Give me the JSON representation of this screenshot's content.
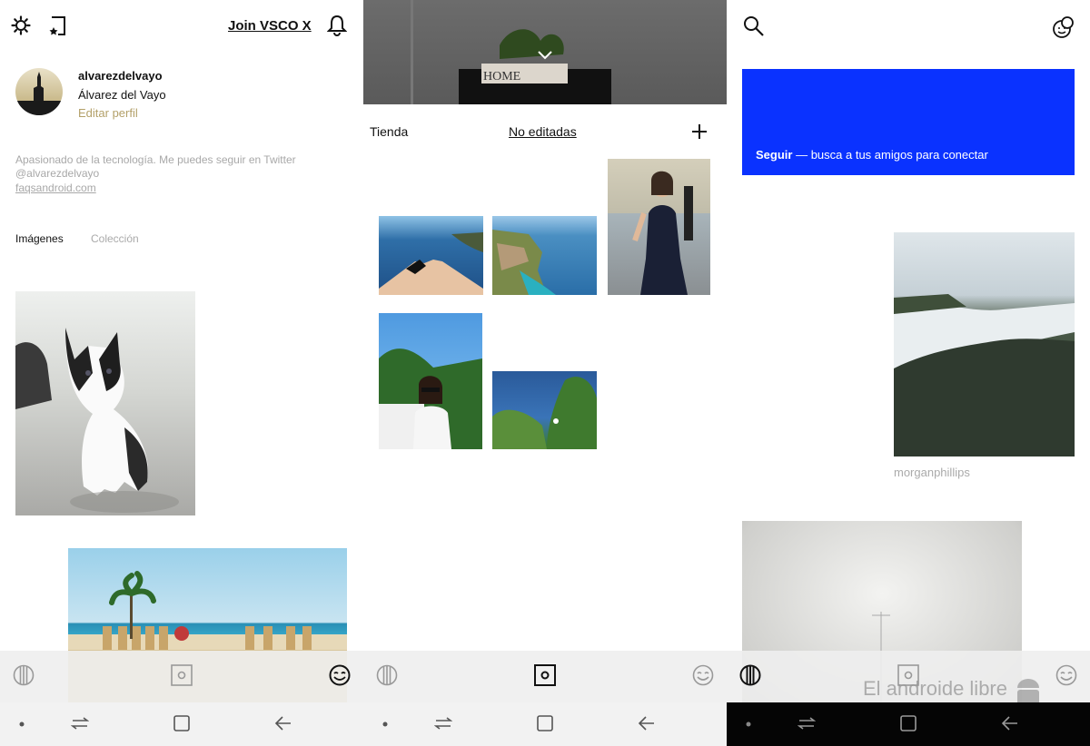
{
  "profile": {
    "join_label": "Join VSCO X",
    "username": "alvarezdelvayo",
    "display_name": "Álvarez del Vayo",
    "edit_label": "Editar perfil",
    "bio_line1": "Apasionado de la tecnología. Me puedes seguir en Twitter",
    "bio_line2": "@alvarezdelvayo",
    "link": "faqsandroid.com",
    "tabs": [
      "Imágenes",
      "Colección"
    ]
  },
  "studio": {
    "shop_label": "Tienda",
    "filter_label": "No editadas"
  },
  "feed": {
    "banner_bold": "Seguir",
    "banner_text": " — busca a tus amigos para conectar",
    "user1": "morganphillips"
  },
  "watermark": "El androide libre",
  "colors": {
    "accent_gold": "#b3a069",
    "banner_blue": "#0a32ff"
  },
  "icons": [
    "settings-icon",
    "bookmark-star-icon",
    "bell-icon",
    "chevron-down-icon",
    "plus-icon",
    "search-icon",
    "faces-icon",
    "feed-icon",
    "studio-icon",
    "profile-face-icon",
    "dot-icon",
    "recents-icon",
    "home-icon",
    "back-icon"
  ]
}
